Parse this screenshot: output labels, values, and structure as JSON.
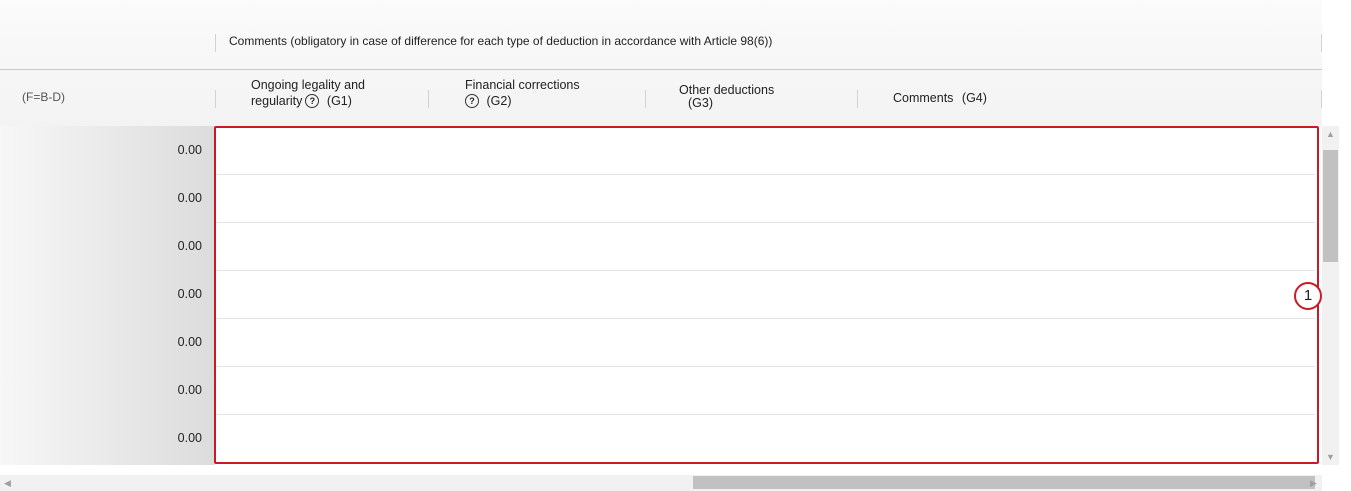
{
  "header": {
    "group_title": "Comments (obligatory in case of difference for each type of deduction in accordance with Article 98(6))",
    "columns": [
      {
        "line1": "(F=B-D)"
      },
      {
        "line1": "Ongoing legality and",
        "line2": "regularity",
        "code": "(G1)",
        "help_icon": "question-circle-icon"
      },
      {
        "line1": "Financial corrections",
        "code": "(G2)",
        "help_icon": "question-circle-icon"
      },
      {
        "line1": "Other deductions",
        "code": "(G3)"
      },
      {
        "line1": "Comments",
        "code": "(G4)"
      }
    ]
  },
  "rows": [
    {
      "value": "0.00"
    },
    {
      "value": "0.00"
    },
    {
      "value": "0.00"
    },
    {
      "value": "0.00"
    },
    {
      "value": "0.00"
    },
    {
      "value": "0.00"
    },
    {
      "value": "0.00"
    }
  ],
  "callout": {
    "label": "1",
    "color": "#cc1a25"
  },
  "scroll": {
    "vertical_position": 0.08,
    "horizontal_position": 0.56
  }
}
